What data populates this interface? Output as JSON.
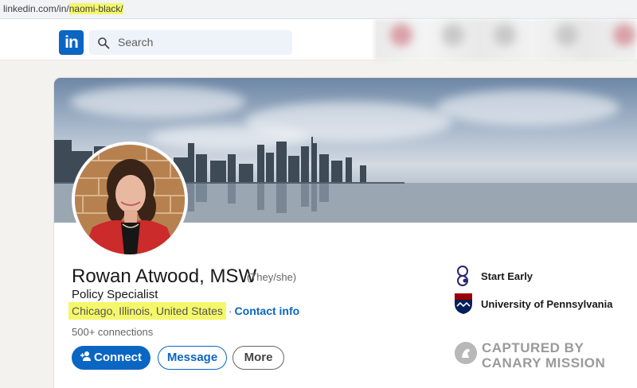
{
  "browser": {
    "url_prefix": "linkedin.com/in/",
    "url_slug": "naomi-black/"
  },
  "navbar": {
    "logo_text": "in",
    "search_placeholder": "Search"
  },
  "profile": {
    "name": "Rowan Atwood, MSW",
    "pronouns": "(They/she)",
    "headline": "Policy Specialist",
    "location": "Chicago, Illinois, United States",
    "separator": "·",
    "contact_info": "Contact info",
    "connections": "500+ connections"
  },
  "actions": {
    "connect": "Connect",
    "message": "Message",
    "more": "More"
  },
  "organizations": [
    {
      "name": "Start Early",
      "icon": "start-early-logo"
    },
    {
      "name": "University of Pennsylvania",
      "icon": "penn-shield-logo"
    }
  ],
  "watermark": {
    "line1": "CAPTURED BY",
    "line2": "CANARY MISSION"
  },
  "colors": {
    "linkedin_blue": "#0a66c2",
    "highlight": "#f5f76a",
    "penn_red": "#990000",
    "penn_blue": "#011f5b"
  }
}
